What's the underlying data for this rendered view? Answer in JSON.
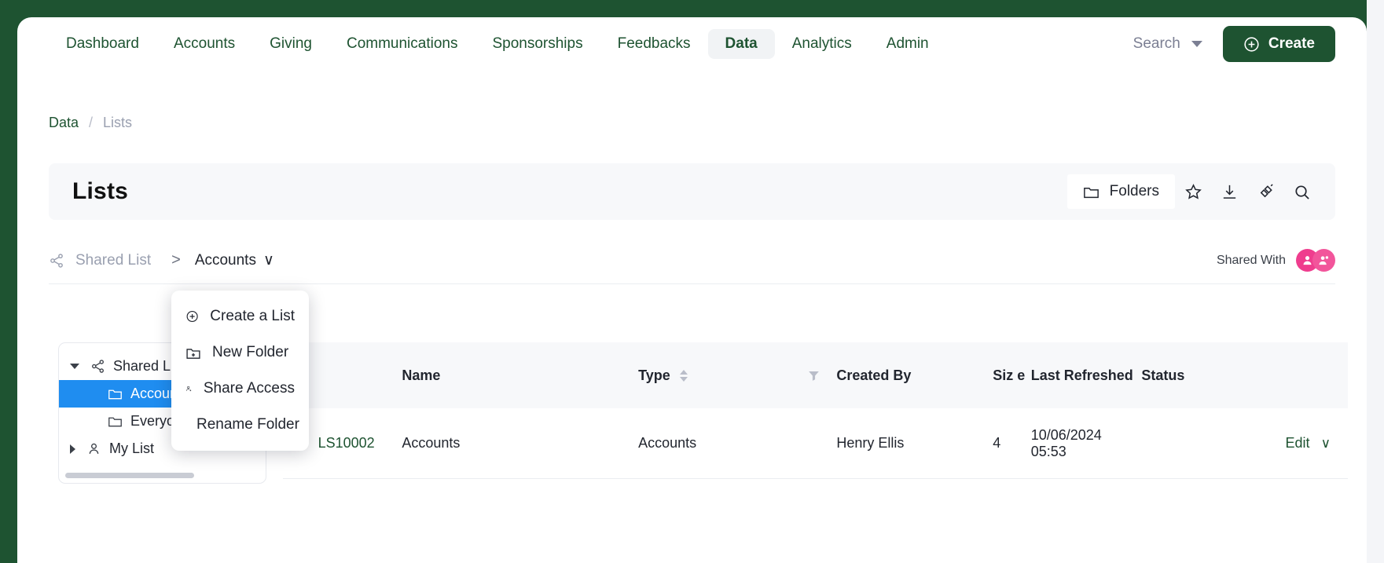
{
  "nav": {
    "items": [
      {
        "label": "Dashboard",
        "active": false
      },
      {
        "label": "Accounts",
        "active": false
      },
      {
        "label": "Giving",
        "active": false
      },
      {
        "label": "Communications",
        "active": false
      },
      {
        "label": "Sponsorships",
        "active": false
      },
      {
        "label": "Feedbacks",
        "active": false
      },
      {
        "label": "Data",
        "active": true
      },
      {
        "label": "Analytics",
        "active": false
      },
      {
        "label": "Admin",
        "active": false
      }
    ],
    "search_label": "Search",
    "create_label": "Create",
    "brand_color": "#1e5331"
  },
  "breadcrumb": {
    "parent": "Data",
    "separator": "/",
    "current": "Lists"
  },
  "title_bar": {
    "title": "Lists",
    "folders_label": "Folders",
    "icons": [
      "folder-icon",
      "star-icon",
      "download-icon",
      "link-icon",
      "search-icon"
    ]
  },
  "shared_row": {
    "shared_list_label": "Shared List",
    "arrow": ">",
    "folder_label": "Accounts",
    "folder_caret": "∨",
    "shared_with_label": "Shared With",
    "avatar_color": "#ef3d8e",
    "avatar_count": 2
  },
  "menu": {
    "items": [
      {
        "label": "Create a List",
        "icon": "plus-circle-icon"
      },
      {
        "label": "New Folder",
        "icon": "folder-plus-icon"
      },
      {
        "label": "Share Access",
        "icon": "person-add-icon"
      },
      {
        "label": "Rename Folder",
        "icon": "pencil-icon"
      }
    ]
  },
  "tree": {
    "nodes": [
      {
        "label": "Shared List",
        "icon": "share-icon",
        "expanded": true,
        "level": 0,
        "selected": false
      },
      {
        "label": "Accounts",
        "icon": "folder-icon",
        "level": 1,
        "selected": true
      },
      {
        "label": "Everyone",
        "icon": "folder-icon",
        "level": 1,
        "selected": false
      },
      {
        "label": "My List",
        "icon": "person-icon",
        "expanded": false,
        "level": 0,
        "selected": false
      }
    ]
  },
  "table": {
    "headers": {
      "id": "",
      "name": "Name",
      "type": "Type",
      "created_by": "Created By",
      "size": "Siz e",
      "last_refreshed": "Last Refreshed",
      "status": "Status",
      "actions": ""
    },
    "rows": [
      {
        "id": "LS10002",
        "name": "Accounts",
        "type": "Accounts",
        "created_by": "Henry Ellis",
        "size": "4",
        "last_refreshed_date": "10/06/2024",
        "last_refreshed_time": "05:53",
        "status_color": "#35c21a",
        "action_label": "Edit",
        "action_caret": "∨"
      }
    ]
  }
}
